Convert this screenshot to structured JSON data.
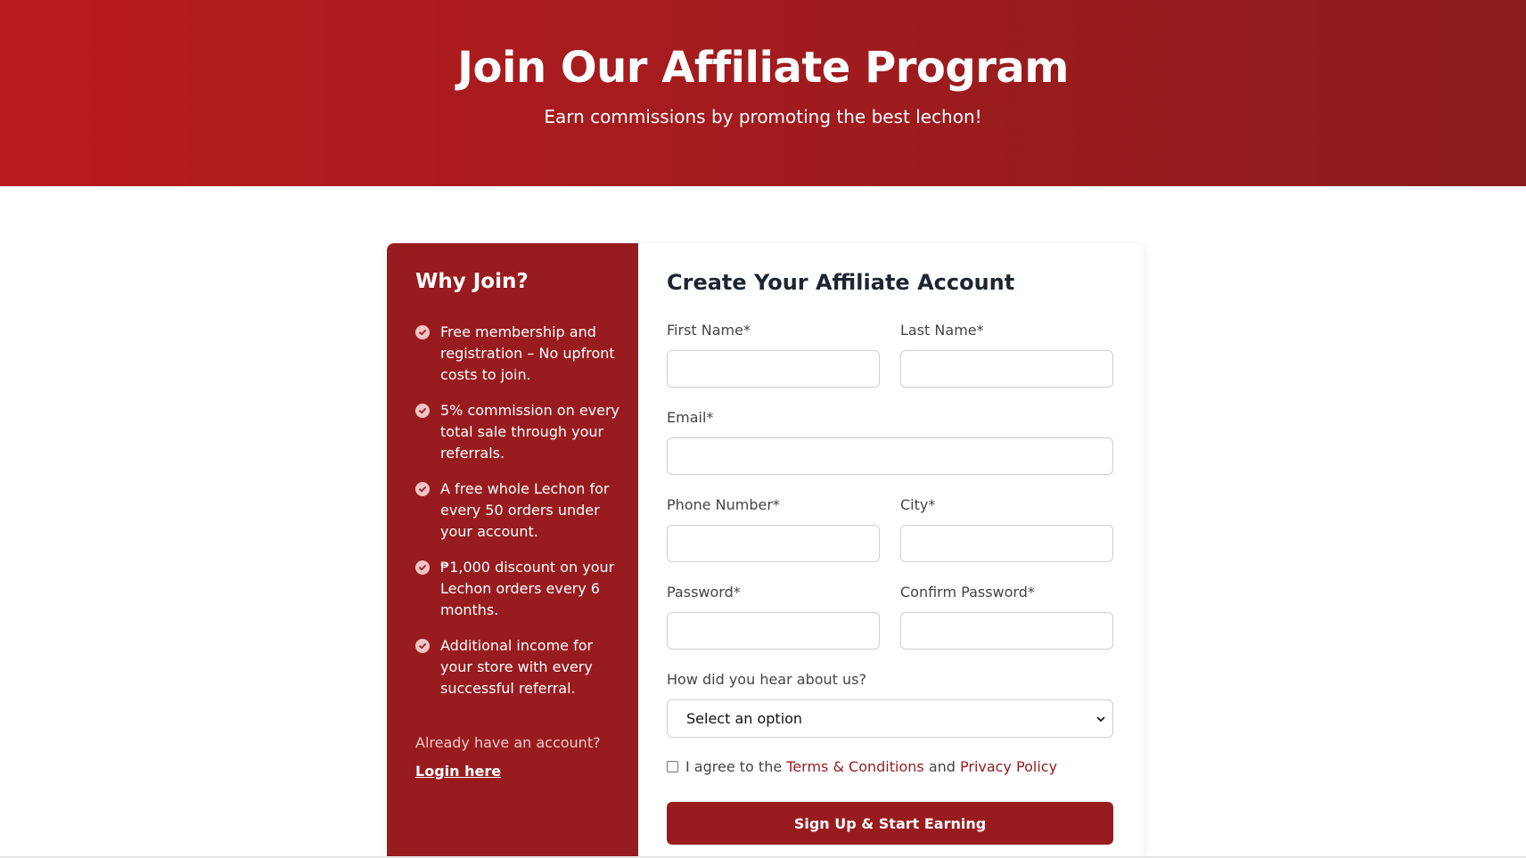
{
  "hero": {
    "title": "Join Our Affiliate Program",
    "subtitle": "Earn commissions by promoting the best lechon!"
  },
  "sidebar": {
    "heading": "Why Join?",
    "benefits": [
      "Free membership and registration – No upfront costs to join.",
      "5% commission on every total sale through your referrals.",
      "A free whole Lechon for every 50 orders under your account.",
      "₱1,000 discount on your Lechon orders every 6 months.",
      "Additional income for your store with every successful referral."
    ],
    "already_text": "Already have an account?",
    "login_label": "Login here"
  },
  "form": {
    "heading": "Create Your Affiliate Account",
    "first_name_label": "First Name*",
    "last_name_label": "Last Name*",
    "email_label": "Email*",
    "phone_label": "Phone Number*",
    "city_label": "City*",
    "password_label": "Password*",
    "confirm_password_label": "Confirm Password*",
    "source_label": "How did you hear about us?",
    "source_selected": "Select an option",
    "agree_prefix": "I agree to the",
    "terms_link": "Terms & Conditions",
    "agree_and": "and",
    "privacy_link": "Privacy Policy",
    "submit_label": "Sign Up & Start Earning"
  },
  "colors": {
    "brand": "#981c1f",
    "hero_gradient_start": "#b81b1e",
    "hero_gradient_end": "#8b1c1f"
  }
}
